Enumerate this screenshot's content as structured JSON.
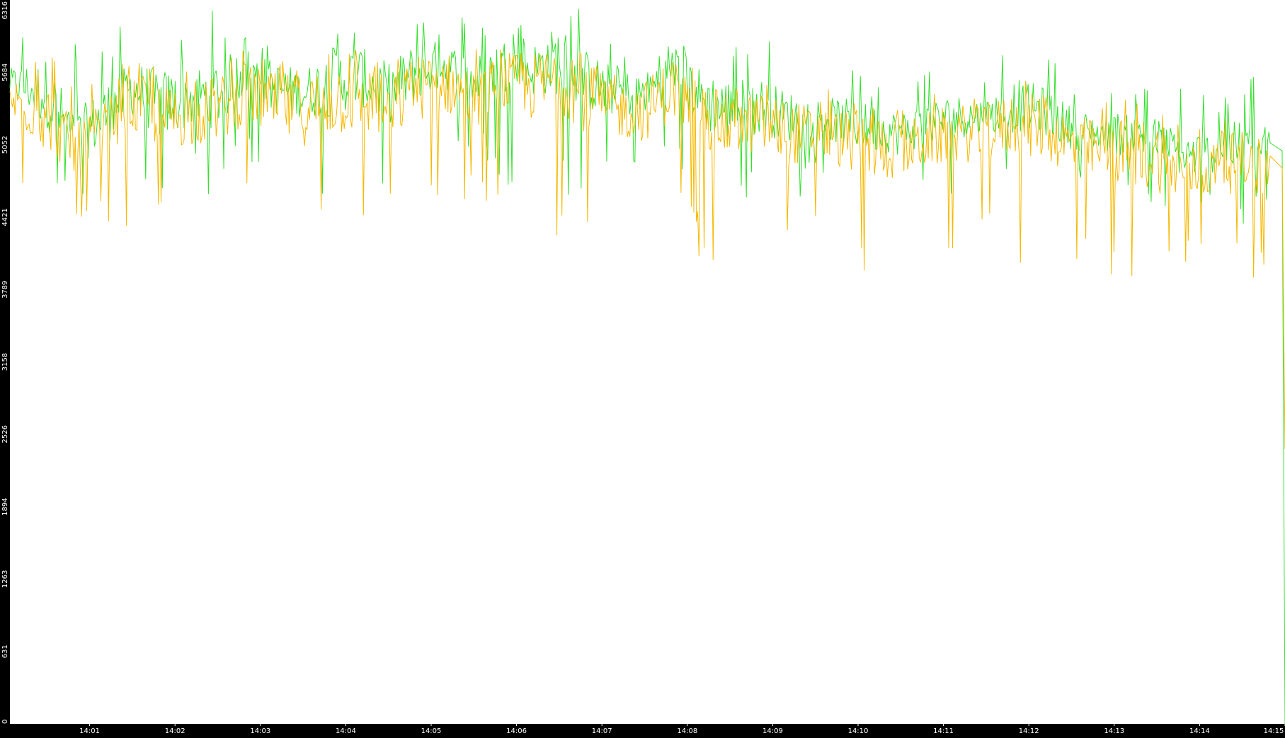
{
  "chart_data": {
    "type": "line",
    "title": "",
    "xlabel": "",
    "ylabel": "",
    "ylim": [
      0,
      6316
    ],
    "y_ticks": [
      "0",
      "631",
      "1263",
      "1894",
      "2526",
      "3158",
      "3789",
      "4421",
      "5052",
      "5684",
      "6316"
    ],
    "x_ticks": [
      "14:01",
      "14:02",
      "14:03",
      "14:04",
      "14:05",
      "14:06",
      "14:07",
      "14:08",
      "14:09",
      "14:10",
      "14:11",
      "14:12",
      "14:13",
      "14:14",
      "14:15"
    ],
    "x_range": [
      "14:00:04",
      "14:15:00"
    ],
    "grid": false,
    "legend": "none",
    "colors": {
      "background": "#000000",
      "plot_area": "#ffffff",
      "tick_text": "#ffffff",
      "series_green": "#33e02a",
      "series_amber": "#f5b800"
    },
    "series": [
      {
        "color": "#33e02a",
        "x": [
          "14:00:04",
          "14:00:30",
          "14:00:50",
          "14:01:10",
          "14:01:30",
          "14:01:50",
          "14:02:10",
          "14:02:30",
          "14:02:50",
          "14:03:10",
          "14:03:30",
          "14:03:50",
          "14:04:10",
          "14:04:30",
          "14:04:50",
          "14:05:10",
          "14:05:30",
          "14:05:50",
          "14:06:10",
          "14:06:30",
          "14:06:50",
          "14:07:10",
          "14:07:30",
          "14:07:50",
          "14:08:10",
          "14:08:30",
          "14:08:50",
          "14:09:10",
          "14:09:30",
          "14:09:50",
          "14:10:10",
          "14:10:30",
          "14:10:50",
          "14:11:10",
          "14:11:30",
          "14:11:50",
          "14:12:10",
          "14:12:30",
          "14:12:50",
          "14:13:10",
          "14:13:30",
          "14:13:50",
          "14:14:10",
          "14:14:30",
          "14:14:50",
          "14:14:58",
          "14:15:00"
        ],
        "min": [
          5300,
          4500,
          4600,
          4400,
          4800,
          4400,
          4700,
          4500,
          4900,
          4700,
          4800,
          4300,
          4600,
          4600,
          4700,
          4900,
          5000,
          4600,
          4900,
          4500,
          4700,
          4600,
          4800,
          4700,
          4500,
          4400,
          4700,
          4400,
          4800,
          4700,
          4400,
          4600,
          4700,
          4600,
          4900,
          4500,
          4700,
          4600,
          4800,
          4400,
          4500,
          4500,
          4400,
          4300,
          4600,
          4700,
          0
        ],
        "avg": [
          5600,
          5500,
          5100,
          5300,
          5550,
          5400,
          5450,
          5500,
          5700,
          5550,
          5500,
          5600,
          5650,
          5500,
          5700,
          5750,
          5600,
          5750,
          5700,
          5800,
          5600,
          5500,
          5500,
          5700,
          5450,
          5350,
          5400,
          5300,
          5300,
          5250,
          5200,
          5150,
          5250,
          5300,
          5300,
          5400,
          5350,
          5200,
          5150,
          5150,
          5100,
          4950,
          5000,
          5050,
          5000,
          5000,
          0
        ],
        "max": [
          6000,
          6300,
          5950,
          6000,
          6200,
          6200,
          6150,
          6250,
          6100,
          6050,
          6000,
          6050,
          6100,
          6150,
          6200,
          6150,
          6250,
          6000,
          6200,
          6300,
          6250,
          5900,
          5800,
          6000,
          6050,
          6000,
          6150,
          5700,
          5800,
          5900,
          5600,
          5700,
          5800,
          5700,
          5800,
          5900,
          5900,
          5700,
          5600,
          5700,
          5600,
          5600,
          5500,
          5600,
          5800,
          5700,
          0
        ]
      },
      {
        "color": "#f5b800",
        "x": [
          "14:00:04",
          "14:00:30",
          "14:00:50",
          "14:01:10",
          "14:01:30",
          "14:01:50",
          "14:02:10",
          "14:02:30",
          "14:02:50",
          "14:03:10",
          "14:03:30",
          "14:03:50",
          "14:04:10",
          "14:04:30",
          "14:04:50",
          "14:05:10",
          "14:05:30",
          "14:05:50",
          "14:06:10",
          "14:06:30",
          "14:06:50",
          "14:07:10",
          "14:07:30",
          "14:07:50",
          "14:08:10",
          "14:08:30",
          "14:08:50",
          "14:09:10",
          "14:09:30",
          "14:09:50",
          "14:10:10",
          "14:10:30",
          "14:10:50",
          "14:11:10",
          "14:11:30",
          "14:11:50",
          "14:12:10",
          "14:12:30",
          "14:12:50",
          "14:13:10",
          "14:13:30",
          "14:13:50",
          "14:14:10",
          "14:14:30",
          "14:14:50",
          "14:14:58",
          "14:15:00"
        ],
        "min": [
          4700,
          4100,
          4300,
          4400,
          4300,
          4200,
          4300,
          4100,
          4400,
          4200,
          4000,
          4000,
          3900,
          4200,
          4300,
          4400,
          4500,
          4400,
          4300,
          4200,
          4100,
          4300,
          4100,
          4200,
          4000,
          4100,
          4200,
          3800,
          4200,
          4000,
          3700,
          4000,
          4100,
          4000,
          4200,
          4000,
          4000,
          3900,
          4000,
          3700,
          3600,
          3900,
          3900,
          3800,
          4000,
          4200,
          2400
        ],
        "avg": [
          5450,
          5300,
          5000,
          5200,
          5400,
          5300,
          5300,
          5350,
          5500,
          5400,
          5350,
          5450,
          5500,
          5350,
          5550,
          5600,
          5450,
          5600,
          5550,
          5650,
          5450,
          5350,
          5350,
          5550,
          5300,
          5200,
          5250,
          5150,
          5150,
          5100,
          5050,
          5000,
          5100,
          5150,
          5150,
          5250,
          5200,
          5050,
          5000,
          5000,
          4950,
          4800,
          4850,
          4900,
          4850,
          4850,
          2400
        ],
        "max": [
          5800,
          5900,
          5600,
          5700,
          5800,
          5750,
          5800,
          5800,
          5900,
          5850,
          5800,
          5900,
          5900,
          5800,
          5950,
          6000,
          5900,
          5900,
          5950,
          6000,
          5850,
          5700,
          5650,
          5800,
          5700,
          5650,
          5700,
          5500,
          5600,
          5500,
          5450,
          5450,
          5500,
          5500,
          5550,
          5650,
          5600,
          5450,
          5450,
          5450,
          5400,
          5300,
          5300,
          5350,
          5400,
          5300,
          2400
        ]
      }
    ]
  }
}
